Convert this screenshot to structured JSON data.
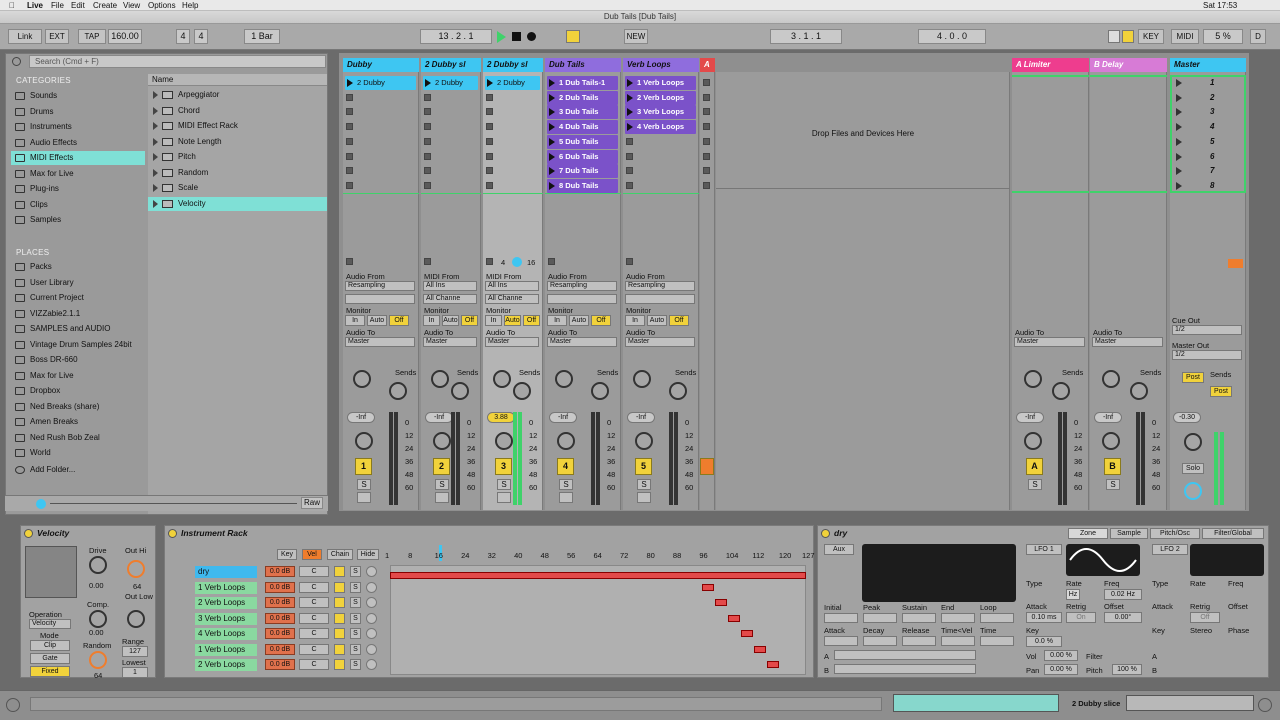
{
  "menubar": {
    "apple": "",
    "app": "Live",
    "items": [
      "File",
      "Edit",
      "Create",
      "View",
      "Help"
    ],
    "extra": "Options",
    "clock": "Sat 17:53"
  },
  "window": {
    "title": "Dub Tails  [Dub Tails]"
  },
  "transport": {
    "link": "Link",
    "ext": "EXT",
    "tap": "TAP",
    "tempo": "160.00",
    "sig_num": "4",
    "sig_den": "4",
    "quant": "1 Bar",
    "position": "13 .  2 .  1",
    "loop_start": "3 .  1 .  1",
    "loop_len": "4 .  0 .  0",
    "new": "NEW",
    "key": "KEY",
    "midi": "MIDI",
    "cpu": "5 %",
    "d": "D"
  },
  "browser": {
    "search_placeholder": "Search (Cmd + F)",
    "categories_label": "CATEGORIES",
    "categories": [
      "Sounds",
      "Drums",
      "Instruments",
      "Audio Effects",
      "MIDI Effects",
      "Max for Live",
      "Plug-ins",
      "Clips",
      "Samples"
    ],
    "places_label": "PLACES",
    "places": [
      "Packs",
      "User Library",
      "Current Project",
      "VIZZabie2.1.1",
      "SAMPLES and AUDIO",
      "Vintage Drum Samples 24bit",
      "Boss DR-660",
      "Max for Live",
      "Dropbox",
      "Ned Breaks (share)",
      "Amen Breaks",
      "Ned Rush Bob Zeal",
      "World"
    ],
    "add_folder": "Add Folder...",
    "name_header": "Name",
    "files": [
      "Arpeggiator",
      "Chord",
      "MIDI Effect Rack",
      "Note Length",
      "Pitch",
      "Random",
      "Scale",
      "Velocity"
    ],
    "raw": "Raw"
  },
  "tracks": [
    {
      "name": "Dubby",
      "color": "#3ec6f2",
      "clips": [
        "2 Dubby"
      ],
      "num": "1",
      "io_type": "Audio From",
      "io_src": "Resampling",
      "vol": "-Inf"
    },
    {
      "name": "2 Dubby sl",
      "color": "#3ec6f2",
      "clips": [
        "2 Dubby"
      ],
      "num": "2",
      "io_type": "MIDI From",
      "io_src": "All Ins",
      "chan": "All Channe",
      "vol": "-Inf"
    },
    {
      "name": "2 Dubby sl",
      "color": "#3ec6f2",
      "clips": [
        "2 Dubby"
      ],
      "num": "3",
      "io_type": "MIDI From",
      "io_src": "All Ins",
      "chan": "All Channe",
      "vol": "3.88"
    },
    {
      "name": "Dub Tails",
      "color": "#8f6ddd",
      "clips": [
        "1 Dub Tails-1",
        "2 Dub Tails",
        "3 Dub Tails",
        "4 Dub Tails",
        "5 Dub Tails",
        "6 Dub Tails",
        "7 Dub Tails",
        "8 Dub Tails"
      ],
      "num": "4",
      "io_type": "Audio From",
      "io_src": "Resampling",
      "vol": "-Inf"
    },
    {
      "name": "Verb Loops",
      "color": "#8f6ddd",
      "clips": [
        "1 Verb Loops",
        "2 Verb Loops",
        "3 Verb Loops",
        "4 Verb Loops"
      ],
      "num": "5",
      "io_type": "Audio From",
      "io_src": "Resampling",
      "vol": "-Inf"
    }
  ],
  "track_a_label": "A",
  "drop_text": "Drop Files and Devices Here",
  "returns": [
    {
      "name": "A Limiter",
      "color": "#ee3d8e",
      "num": "A"
    },
    {
      "name": "B Delay",
      "color": "#d77bd6",
      "num": "B"
    }
  ],
  "master": {
    "name": "Master",
    "scenes": [
      "1",
      "2",
      "3",
      "4",
      "5",
      "6",
      "7",
      "8"
    ],
    "vol": "-0.30",
    "cue_out": "Cue Out",
    "cue_val": "1/2",
    "master_out": "Master Out",
    "master_val": "1/2",
    "post": "Post"
  },
  "mixer_labels": {
    "monitor": "Monitor",
    "in": "In",
    "auto": "Auto",
    "off": "Off",
    "audio_to": "Audio To",
    "master": "Master",
    "sends": "Sends",
    "s": "S",
    "solo": "Solo",
    "ticks": [
      "0",
      "12",
      "24",
      "36",
      "48",
      "60"
    ],
    "dubby_sl3_extra": [
      "4",
      "16"
    ]
  },
  "velocity_device": {
    "title": "Velocity",
    "drive": "Drive",
    "drive_val": "0.00",
    "out_hi": "Out Hi",
    "out_hi_val": "64",
    "comp": "Comp.",
    "comp_val": "0.00",
    "out_low": "Out Low",
    "operation": "Operation",
    "operation_val": "Velocity",
    "mode": "Mode",
    "clip": "Clip",
    "gate": "Gate",
    "fixed": "Fixed",
    "random": "Random",
    "random_val": "64",
    "range": "Range",
    "range_val": "127",
    "lowest": "Lowest",
    "lowest_val": "1"
  },
  "rack": {
    "title": "Instrument Rack",
    "key": "Key",
    "vel": "Vel",
    "chain": "Chain",
    "hide": "Hide",
    "ruler": [
      "1",
      "8",
      "16",
      "24",
      "32",
      "40",
      "48",
      "56",
      "64",
      "72",
      "80",
      "88",
      "96",
      "104",
      "112",
      "120",
      "127"
    ],
    "chains": [
      {
        "name": "dry",
        "vol": "0.0 dB",
        "pan": "C"
      },
      {
        "name": "1 Verb Loops",
        "vol": "0.0 dB",
        "pan": "C"
      },
      {
        "name": "2 Verb Loops",
        "vol": "0.0 dB",
        "pan": "C"
      },
      {
        "name": "3 Verb Loops",
        "vol": "0.0 dB",
        "pan": "C"
      },
      {
        "name": "4 Verb Loops",
        "vol": "0.0 dB",
        "pan": "C"
      },
      {
        "name": "1 Verb Loops",
        "vol": "0.0 dB",
        "pan": "C"
      },
      {
        "name": "2 Verb Loops",
        "vol": "0.0 dB",
        "pan": "C"
      }
    ]
  },
  "sampler": {
    "title": "dry",
    "tabs": [
      "Zone",
      "Sample",
      "Pitch/Osc",
      "Filter/Global"
    ],
    "aux": "Aux",
    "lfo1": "LFO 1",
    "lfo2": "LFO 2",
    "type": "Type",
    "rate": "Rate",
    "freq": "Freq",
    "hz": "Hz",
    "freq_val": "0.02 Hz",
    "attack": "Attack",
    "attack_val": "0.10 ms",
    "retrig": "Retrig",
    "on": "On",
    "offset": "Offset",
    "offset_val": "0.00°",
    "key": "Key",
    "key_val": "0.0 %",
    "phase": "Phase",
    "env_cols": [
      "Initial",
      "Peak",
      "Sustain",
      "End",
      "Loop"
    ],
    "env_cols2": [
      "Attack",
      "Decay",
      "Release",
      "Time<Vel",
      "Time"
    ],
    "vol": "Vol",
    "vol_val": "0.00 %",
    "filter": "Filter",
    "pan": "Pan",
    "pan_val": "0.00 %",
    "pitch": "Pitch",
    "pitch_val": "100 %",
    "stereo": "Stereo",
    "off": "Off",
    "a": "A",
    "b": "B"
  },
  "status": {
    "clip": "2 Dubby slice"
  }
}
